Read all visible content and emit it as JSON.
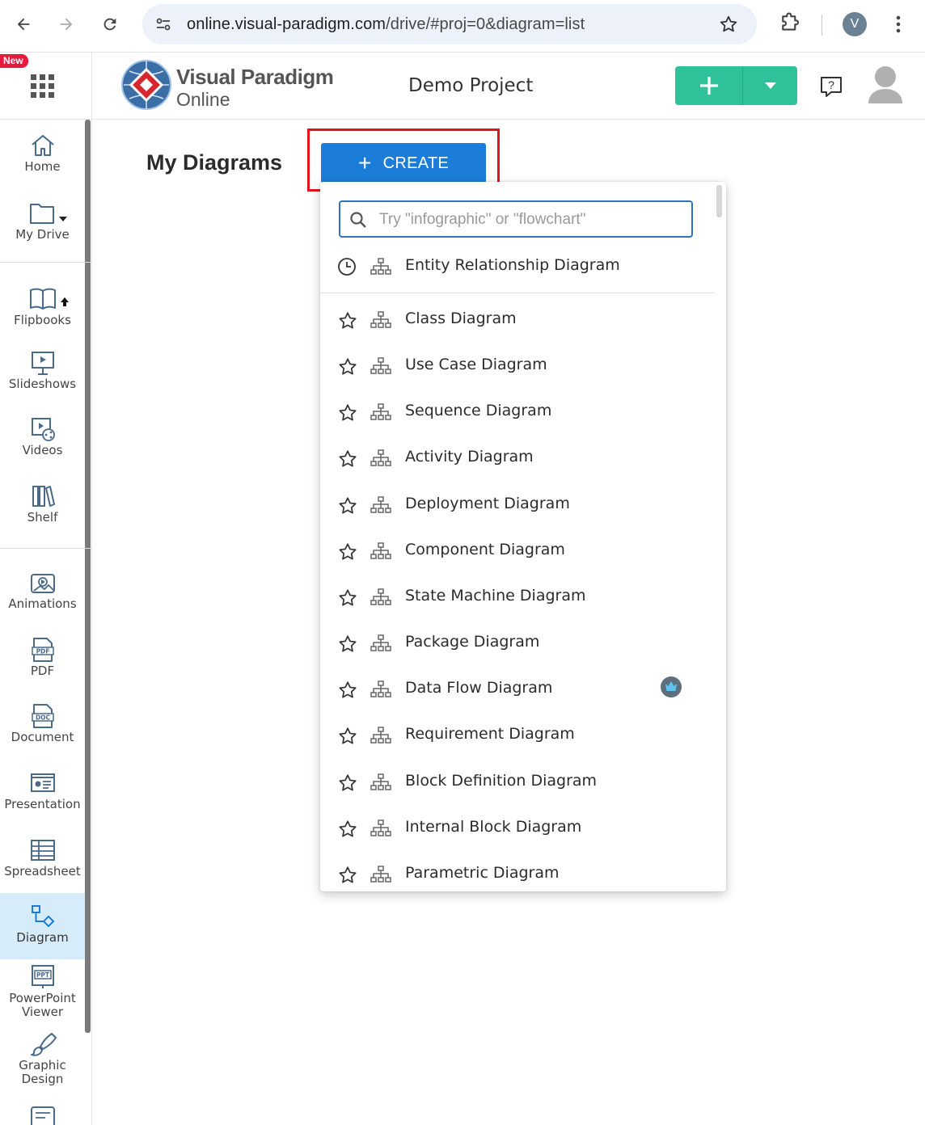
{
  "browser": {
    "url_host": "online.visual-paradigm.com",
    "url_path": "/drive/#proj=0&diagram=list",
    "profile_initial": "V"
  },
  "header": {
    "new_badge": "New",
    "brand_line1": "Visual Paradigm",
    "brand_line2": "Online",
    "project_name": "Demo Project"
  },
  "sidebar": {
    "items": [
      {
        "label": "Home",
        "icon": "home-icon"
      },
      {
        "label": "My Drive",
        "icon": "folder-icon"
      },
      {
        "label": "Flipbooks",
        "icon": "book-icon"
      },
      {
        "label": "Slideshows",
        "icon": "slideshow-icon"
      },
      {
        "label": "Videos",
        "icon": "video-icon"
      },
      {
        "label": "Shelf",
        "icon": "shelf-icon"
      },
      {
        "label": "Animations",
        "icon": "animation-icon"
      },
      {
        "label": "PDF",
        "icon": "pdf-icon"
      },
      {
        "label": "Document",
        "icon": "doc-icon"
      },
      {
        "label": "Presentation",
        "icon": "presentation-icon"
      },
      {
        "label": "Spreadsheet",
        "icon": "spreadsheet-icon"
      },
      {
        "label": "Diagram",
        "icon": "diagram-icon"
      },
      {
        "label": "PowerPoint\nViewer",
        "icon": "ppt-icon"
      },
      {
        "label": "Graphic\nDesign",
        "icon": "brush-icon"
      }
    ],
    "active": "Diagram"
  },
  "main": {
    "title": "My Diagrams",
    "create_label": "CREATE"
  },
  "dropdown": {
    "search_placeholder": "Try \"infographic\" or \"flowchart\"",
    "recent": [
      {
        "name": "Entity Relationship Diagram"
      }
    ],
    "items": [
      {
        "name": "Class Diagram",
        "premium": false
      },
      {
        "name": "Use Case Diagram",
        "premium": false
      },
      {
        "name": "Sequence Diagram",
        "premium": false
      },
      {
        "name": "Activity Diagram",
        "premium": false
      },
      {
        "name": "Deployment Diagram",
        "premium": false
      },
      {
        "name": "Component Diagram",
        "premium": false
      },
      {
        "name": "State Machine Diagram",
        "premium": false
      },
      {
        "name": "Package Diagram",
        "premium": false
      },
      {
        "name": "Data Flow Diagram",
        "premium": true
      },
      {
        "name": "Requirement Diagram",
        "premium": false
      },
      {
        "name": "Block Definition Diagram",
        "premium": false
      },
      {
        "name": "Internal Block Diagram",
        "premium": false
      },
      {
        "name": "Parametric Diagram",
        "premium": false
      }
    ]
  },
  "colors": {
    "accent_green": "#2fc29a",
    "create_blue": "#1b7dd8",
    "highlight_red": "#e3141c",
    "active_bg": "#d6ecfa"
  }
}
